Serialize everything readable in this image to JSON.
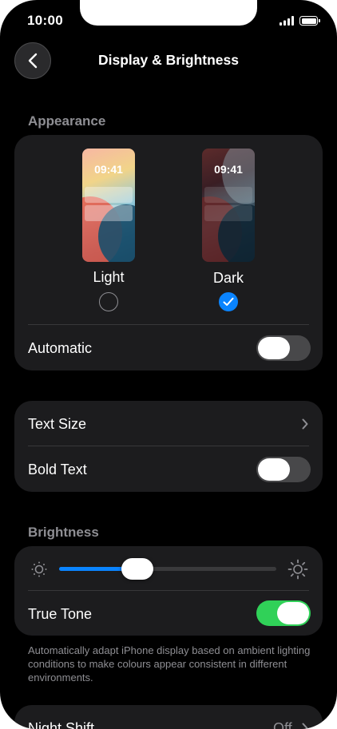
{
  "status_bar": {
    "time": "10:00"
  },
  "nav": {
    "title": "Display & Brightness"
  },
  "appearance": {
    "section_label": "Appearance",
    "light": {
      "label": "Light",
      "preview_time": "09:41",
      "selected": false
    },
    "dark": {
      "label": "Dark",
      "preview_time": "09:41",
      "selected": true
    },
    "automatic": {
      "label": "Automatic",
      "on": false
    }
  },
  "text_group": {
    "text_size_label": "Text Size",
    "bold_text": {
      "label": "Bold Text",
      "on": false
    }
  },
  "brightness": {
    "section_label": "Brightness",
    "level": 0.36,
    "true_tone": {
      "label": "True Tone",
      "on": true
    },
    "footnote": "Automatically adapt iPhone display based on ambient lighting conditions to make colours appear consistent in different environments."
  },
  "night_shift": {
    "label": "Night Shift",
    "value": "Off"
  },
  "colors": {
    "accent_blue": "#0a84ff",
    "toggle_on_green": "#30d158",
    "card_bg": "#1c1c1e"
  }
}
